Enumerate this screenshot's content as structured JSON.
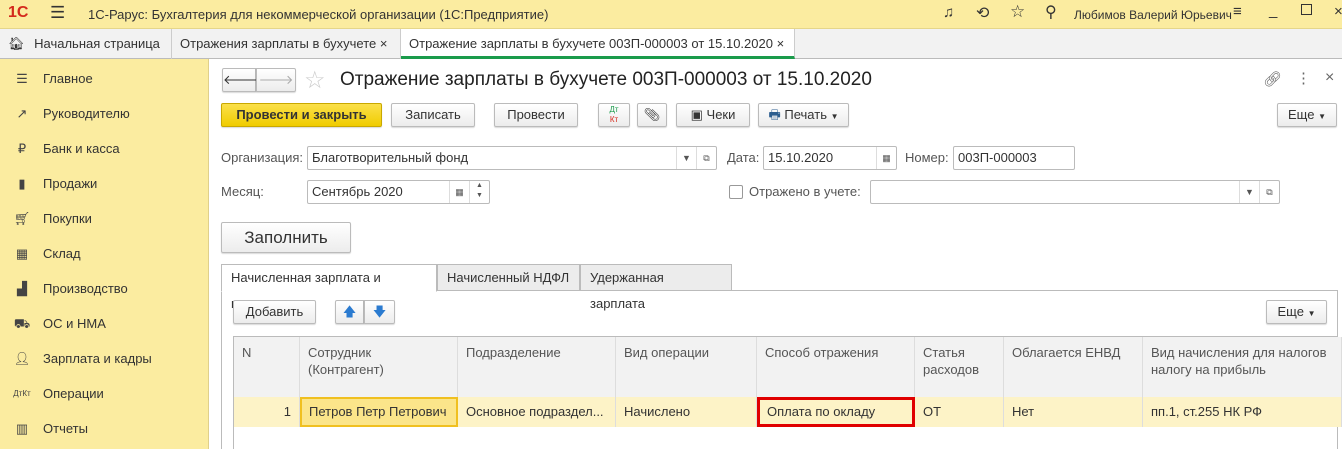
{
  "titlebar": {
    "logo": "1С",
    "title": "1С-Рарус: Бухгалтерия для некоммерческой организации  (1С:Предприятие)",
    "user": "Любимов Валерий Юрьевич"
  },
  "open_tabs": [
    {
      "label": "Начальная страница"
    },
    {
      "label": "Отражения зарплаты в бухучете"
    },
    {
      "label": "Отражение зарплаты в бухучете 003П-000003 от 15.10.2020"
    }
  ],
  "sidebar": {
    "items": [
      {
        "label": "Главное",
        "icon": "menu-icon"
      },
      {
        "label": "Руководителю",
        "icon": "chart-line-icon"
      },
      {
        "label": "Банк и касса",
        "icon": "ruble-icon"
      },
      {
        "label": "Продажи",
        "icon": "bag-icon"
      },
      {
        "label": "Покупки",
        "icon": "cart-icon"
      },
      {
        "label": "Склад",
        "icon": "warehouse-icon"
      },
      {
        "label": "Производство",
        "icon": "factory-icon"
      },
      {
        "label": "ОС и НМА",
        "icon": "truck-icon"
      },
      {
        "label": "Зарплата и кадры",
        "icon": "person-icon"
      },
      {
        "label": "Операции",
        "icon": "dt-kt-icon"
      },
      {
        "label": "Отчеты",
        "icon": "bar-chart-icon"
      }
    ]
  },
  "document": {
    "title": "Отражение зарплаты в бухучете 003П-000003 от 15.10.2020"
  },
  "toolbar": {
    "post_close": "Провести и закрыть",
    "save": "Записать",
    "post": "Провести",
    "dtkt_dt": "Дт",
    "dtkt_kt": "Кт",
    "receipts": "Чеки",
    "print": "Печать",
    "more": "Еще"
  },
  "form": {
    "org_label": "Организация:",
    "org_value": "Благотворительный фонд",
    "date_label": "Дата:",
    "date_value": "15.10.2020",
    "number_label": "Номер:",
    "number_value": "003П-000003",
    "month_label": "Месяц:",
    "month_value": "Сентябрь 2020",
    "reflected_label": "Отражено в учете:",
    "reflected_checked": false,
    "reflected_value": "",
    "fill": "Заполнить"
  },
  "form_tabs": [
    "Начисленная зарплата и взносы",
    "Начисленный НДФЛ",
    "Удержанная зарплата"
  ],
  "table_toolbar": {
    "add": "Добавить",
    "more": "Еще"
  },
  "table": {
    "columns": [
      "N",
      "Сотрудник (Контрагент)",
      "Подразделение",
      "Вид операции",
      "Способ отражения",
      "Статья расходов",
      "Облагается ЕНВД",
      "Вид начисления для налогов налогу на прибыль"
    ],
    "rows": [
      [
        "1",
        "Петров Петр Петрович",
        "Основное подраздел...",
        "Начислено",
        "Оплата по окладу",
        "ОТ",
        "Нет",
        "пп.1, ст.255 НК РФ"
      ]
    ]
  },
  "colors": {
    "accent_yellow": "#f5d311",
    "sidebar_bg": "#fbeca0",
    "highlight": "#e00000",
    "active_tab_underline": "#1a9b4b"
  }
}
